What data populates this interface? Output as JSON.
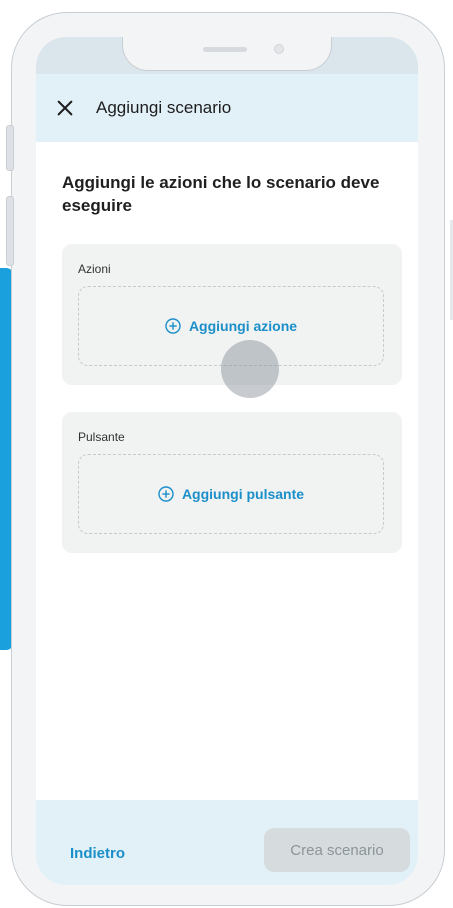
{
  "header": {
    "title": "Aggiungi scenario"
  },
  "page": {
    "instructions": "Aggiungi le azioni che lo scenario deve eseguire"
  },
  "actions_section": {
    "label": "Azioni",
    "add_label": "Aggiungi azione"
  },
  "button_section": {
    "label": "Pulsante",
    "add_label": "Aggiungi pulsante"
  },
  "footer": {
    "back_label": "Indietro",
    "create_label": "Crea scenario"
  },
  "icons": {
    "close": "close-icon",
    "add": "plus-circle-icon"
  },
  "colors": {
    "accent": "#1b8fc9",
    "header_bg": "#e2f1f8",
    "disabled_bg": "#d6dbdd"
  }
}
